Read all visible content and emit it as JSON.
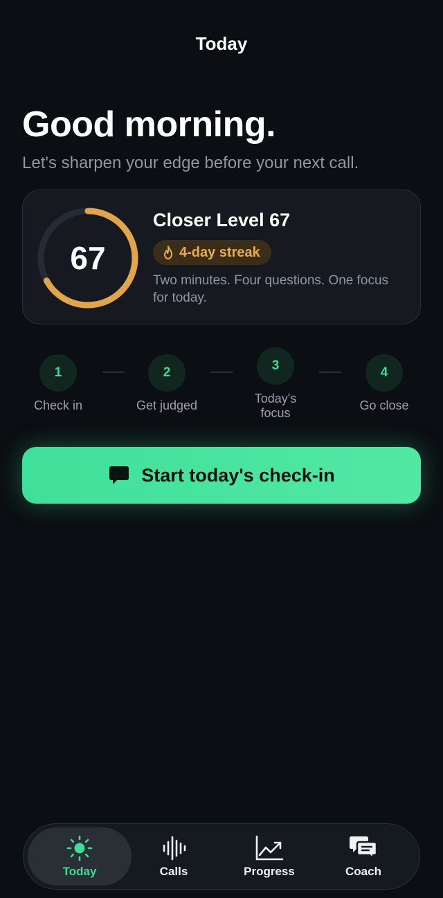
{
  "header": {
    "title": "Today"
  },
  "greeting": {
    "title": "Good morning.",
    "subtitle": "Let's sharpen your edge before your next call."
  },
  "level_card": {
    "score": "67",
    "score_fraction": 0.67,
    "title": "Closer Level 67",
    "streak": "4-day streak",
    "description": "Two minutes. Four questions. One focus for today.",
    "ring_color": "#e2a64a",
    "ring_track_color": "#262b33"
  },
  "steps": [
    {
      "number": "1",
      "label": "Check in"
    },
    {
      "number": "2",
      "label": "Get judged"
    },
    {
      "number": "3",
      "label": "Today's focus"
    },
    {
      "number": "4",
      "label": "Go close"
    }
  ],
  "cta": {
    "label": "Start today's check-in",
    "icon": "chat-bubble-icon"
  },
  "tabbar": {
    "items": [
      {
        "label": "Today",
        "icon": "sun-icon",
        "active": true
      },
      {
        "label": "Calls",
        "icon": "waveform-icon",
        "active": false
      },
      {
        "label": "Progress",
        "icon": "chart-up-icon",
        "active": false
      },
      {
        "label": "Coach",
        "icon": "chat-bubbles-icon",
        "active": false
      }
    ]
  },
  "colors": {
    "background": "#0b0e12",
    "accent_green": "#3ddc97",
    "accent_gold": "#e2a64a"
  }
}
